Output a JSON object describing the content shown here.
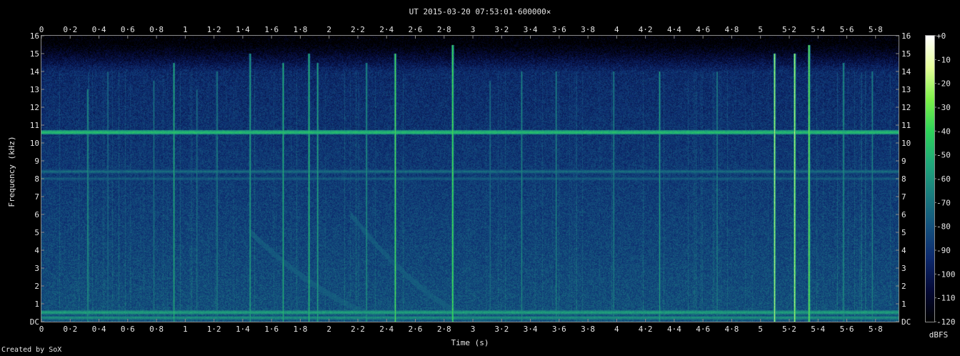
{
  "chart_data": {
    "type": "heatmap",
    "title": "UT 2015-03-20 07:53:01·600000×",
    "xlabel": "Time (s)",
    "ylabel": "Frequency (kHz)",
    "xlim": [
      0,
      5.96
    ],
    "ylim": [
      0,
      16
    ],
    "x_ticks": [
      {
        "v": 0,
        "label": "0"
      },
      {
        "v": 0.2,
        "label": "0·2"
      },
      {
        "v": 0.4,
        "label": "0·4"
      },
      {
        "v": 0.6,
        "label": "0·6"
      },
      {
        "v": 0.8,
        "label": "0·8"
      },
      {
        "v": 1,
        "label": "1"
      },
      {
        "v": 1.2,
        "label": "1·2"
      },
      {
        "v": 1.4,
        "label": "1·4"
      },
      {
        "v": 1.6,
        "label": "1·6"
      },
      {
        "v": 1.8,
        "label": "1·8"
      },
      {
        "v": 2,
        "label": "2"
      },
      {
        "v": 2.2,
        "label": "2·2"
      },
      {
        "v": 2.4,
        "label": "2·4"
      },
      {
        "v": 2.6,
        "label": "2·6"
      },
      {
        "v": 2.8,
        "label": "2·8"
      },
      {
        "v": 3,
        "label": "3"
      },
      {
        "v": 3.2,
        "label": "3·2"
      },
      {
        "v": 3.4,
        "label": "3·4"
      },
      {
        "v": 3.6,
        "label": "3·6"
      },
      {
        "v": 3.8,
        "label": "3·8"
      },
      {
        "v": 4,
        "label": "4"
      },
      {
        "v": 4.2,
        "label": "4·2"
      },
      {
        "v": 4.4,
        "label": "4·4"
      },
      {
        "v": 4.6,
        "label": "4·6"
      },
      {
        "v": 4.8,
        "label": "4·8"
      },
      {
        "v": 5,
        "label": "5"
      },
      {
        "v": 5.2,
        "label": "5·2"
      },
      {
        "v": 5.4,
        "label": "5·4"
      },
      {
        "v": 5.6,
        "label": "5·6"
      },
      {
        "v": 5.8,
        "label": "5·8"
      }
    ],
    "y_ticks": [
      {
        "v": 0,
        "label": "DC"
      },
      {
        "v": 1,
        "label": "1"
      },
      {
        "v": 2,
        "label": "2"
      },
      {
        "v": 3,
        "label": "3"
      },
      {
        "v": 4,
        "label": "4"
      },
      {
        "v": 5,
        "label": "5"
      },
      {
        "v": 6,
        "label": "6"
      },
      {
        "v": 7,
        "label": "7"
      },
      {
        "v": 8,
        "label": "8"
      },
      {
        "v": 9,
        "label": "9"
      },
      {
        "v": 10,
        "label": "10"
      },
      {
        "v": 11,
        "label": "11"
      },
      {
        "v": 12,
        "label": "12"
      },
      {
        "v": 13,
        "label": "13"
      },
      {
        "v": 14,
        "label": "14"
      },
      {
        "v": 15,
        "label": "15"
      },
      {
        "v": 16,
        "label": "16"
      }
    ],
    "colorbar": {
      "label": "dBFS",
      "range": [
        -120,
        0
      ],
      "ticks": [
        {
          "v": 0,
          "label": "+0"
        },
        {
          "v": -10,
          "label": "-10"
        },
        {
          "v": -20,
          "label": "-20"
        },
        {
          "v": -30,
          "label": "-30"
        },
        {
          "v": -40,
          "label": "-40"
        },
        {
          "v": -50,
          "label": "-50"
        },
        {
          "v": -60,
          "label": "-60"
        },
        {
          "v": -70,
          "label": "-70"
        },
        {
          "v": -80,
          "label": "-80"
        },
        {
          "v": -90,
          "label": "-90"
        },
        {
          "v": -100,
          "label": "-100"
        },
        {
          "v": -110,
          "label": "-110"
        },
        {
          "v": -120,
          "label": "-120"
        }
      ],
      "colormap": [
        "#000000",
        "#050a38",
        "#0d2a6e",
        "#14527e",
        "#1a7d7e",
        "#20a87a",
        "#2ed35a",
        "#7ef04a",
        "#e6ff9a",
        "#ffffff"
      ]
    },
    "features": {
      "tones_khz": [
        {
          "f": 10.6,
          "level": 0.62
        },
        {
          "f": 8.4,
          "level": 0.42
        },
        {
          "f": 8.0,
          "level": 0.38
        },
        {
          "f": 0.5,
          "level": 0.55
        },
        {
          "f": 0.2,
          "level": 0.5
        }
      ],
      "sferics": [
        {
          "t": 0.32,
          "f_top": 13.0,
          "level": 0.55
        },
        {
          "t": 0.46,
          "f_top": 14.0,
          "level": 0.45
        },
        {
          "t": 0.78,
          "f_top": 13.5,
          "level": 0.45
        },
        {
          "t": 0.92,
          "f_top": 14.5,
          "level": 0.6
        },
        {
          "t": 1.08,
          "f_top": 13.0,
          "level": 0.45
        },
        {
          "t": 1.22,
          "f_top": 14.0,
          "level": 0.5
        },
        {
          "t": 1.45,
          "f_top": 15.0,
          "level": 0.6
        },
        {
          "t": 1.68,
          "f_top": 14.5,
          "level": 0.6
        },
        {
          "t": 1.86,
          "f_top": 15.0,
          "level": 0.65
        },
        {
          "t": 1.92,
          "f_top": 14.5,
          "level": 0.6
        },
        {
          "t": 2.26,
          "f_top": 14.5,
          "level": 0.55
        },
        {
          "t": 2.46,
          "f_top": 15.0,
          "level": 0.75
        },
        {
          "t": 2.86,
          "f_top": 15.5,
          "level": 0.8
        },
        {
          "t": 3.12,
          "f_top": 13.5,
          "level": 0.45
        },
        {
          "t": 3.34,
          "f_top": 14.0,
          "level": 0.5
        },
        {
          "t": 3.58,
          "f_top": 14.0,
          "level": 0.5
        },
        {
          "t": 3.98,
          "f_top": 14.0,
          "level": 0.5
        },
        {
          "t": 4.3,
          "f_top": 14.0,
          "level": 0.55
        },
        {
          "t": 4.7,
          "f_top": 14.0,
          "level": 0.5
        },
        {
          "t": 5.1,
          "f_top": 15.0,
          "level": 0.85
        },
        {
          "t": 5.24,
          "f_top": 15.0,
          "level": 0.9
        },
        {
          "t": 5.34,
          "f_top": 15.5,
          "level": 0.85
        },
        {
          "t": 5.58,
          "f_top": 14.5,
          "level": 0.55
        },
        {
          "t": 5.78,
          "f_top": 14.0,
          "level": 0.5
        }
      ],
      "whistlers": [
        {
          "t0": 1.45,
          "t1": 2.5,
          "f0": 5.0,
          "level": 0.35
        },
        {
          "t0": 2.15,
          "t1": 3.1,
          "f0": 6.0,
          "level": 0.35
        }
      ]
    }
  },
  "credit": "Created by SoX"
}
